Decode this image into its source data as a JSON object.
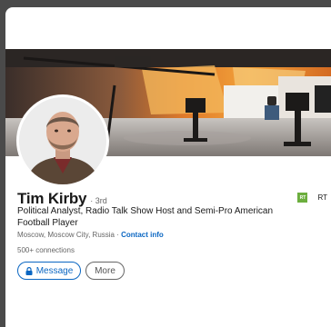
{
  "profile": {
    "name": "Tim Kirby",
    "degree": "· 3rd",
    "headline": "Political Analyst, Radio Talk Show Host and Semi-Pro American Football Player",
    "location": "Moscow, Moscow City, Russia",
    "location_separator": " · ",
    "contact_info": "Contact info",
    "connections": "500+ connections"
  },
  "actions": {
    "message_label": "Message",
    "more_label": "More"
  },
  "company": {
    "logo_text": "RT",
    "name": "RT"
  },
  "icons": {
    "message": "lock-icon"
  },
  "colors": {
    "accent": "#0a66c2",
    "card_bg": "#ffffff",
    "page_bg": "#4a4a4a",
    "company_logo": "#6cae3e"
  }
}
